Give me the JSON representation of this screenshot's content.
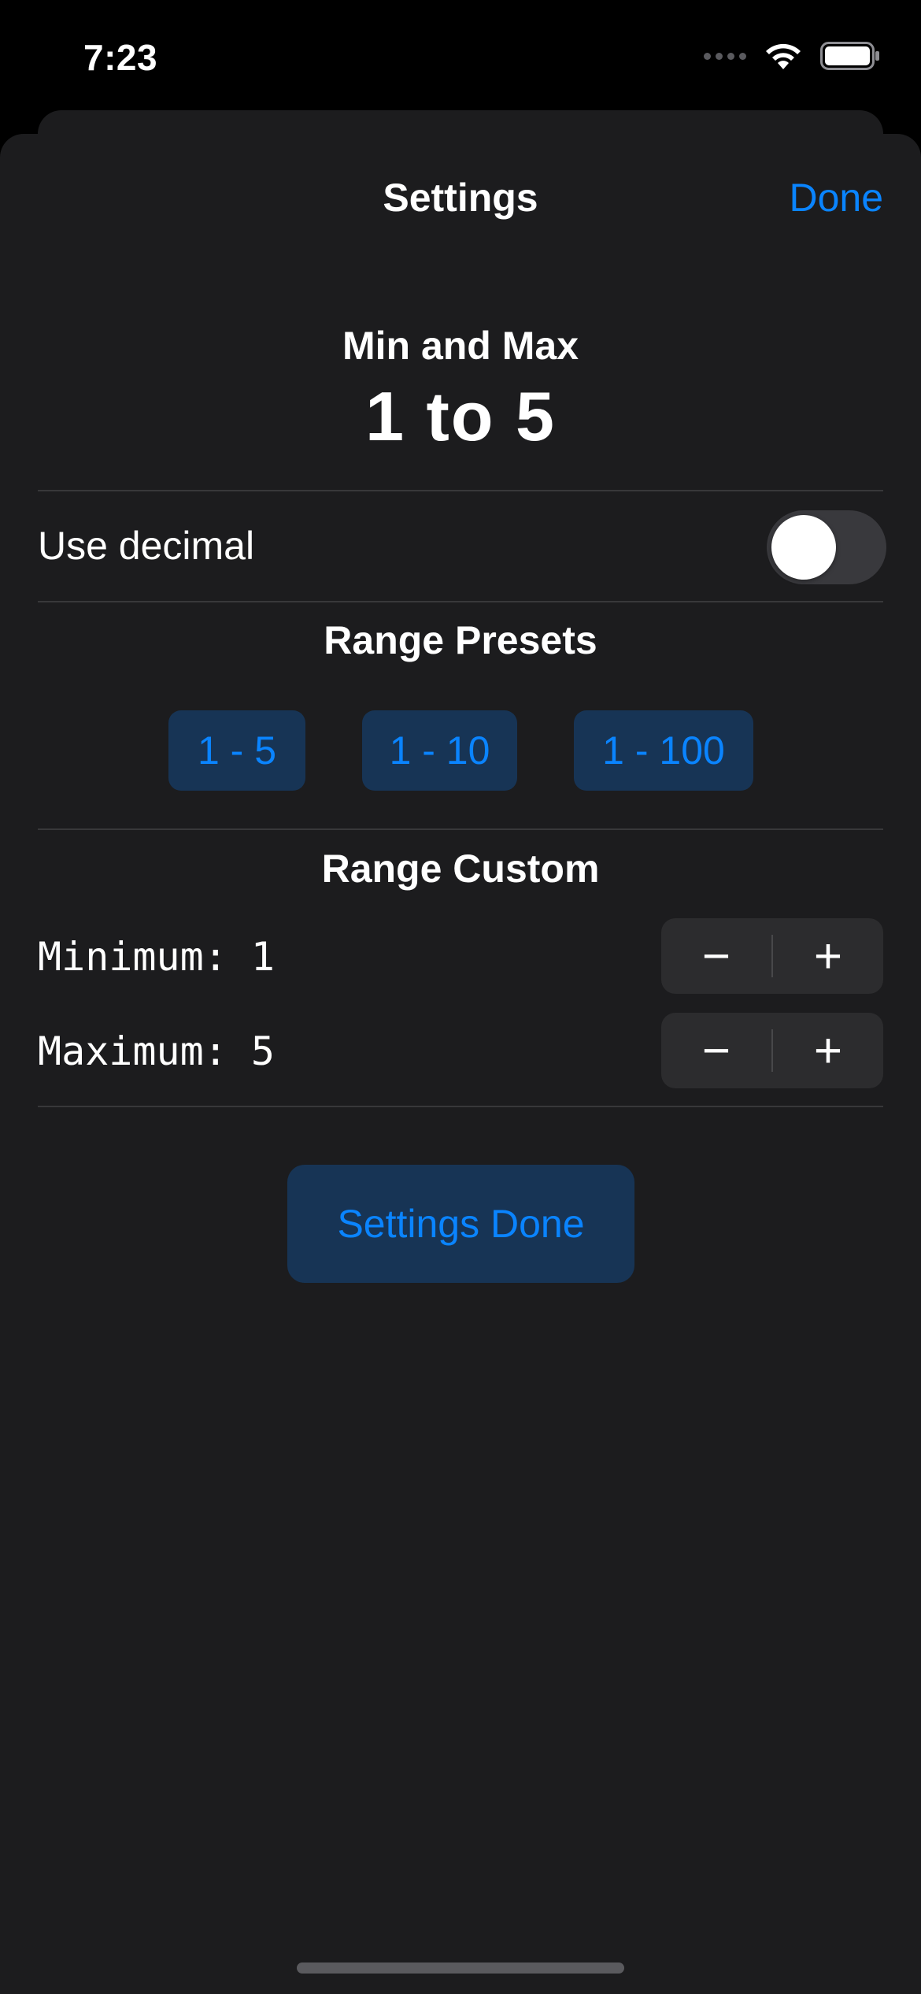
{
  "status_bar": {
    "time": "7:23"
  },
  "nav": {
    "title": "Settings",
    "done_label": "Done"
  },
  "header": {
    "subtitle": "Min and Max",
    "range_text": "1 to 5"
  },
  "decimal_toggle": {
    "label": "Use decimal",
    "value": false
  },
  "range_presets": {
    "title": "Range Presets",
    "options": [
      "1 - 5",
      "1 - 10",
      "1 - 100"
    ]
  },
  "range_custom": {
    "title": "Range Custom",
    "minimum_label": "Minimum: 1",
    "maximum_label": "Maximum: 5",
    "decrement_symbol": "−",
    "increment_symbol": "+"
  },
  "primary_action": {
    "label": "Settings Done"
  },
  "colors": {
    "accent": "#0a84ff",
    "button_bg": "#173455",
    "sheet_bg": "#1c1c1e"
  }
}
